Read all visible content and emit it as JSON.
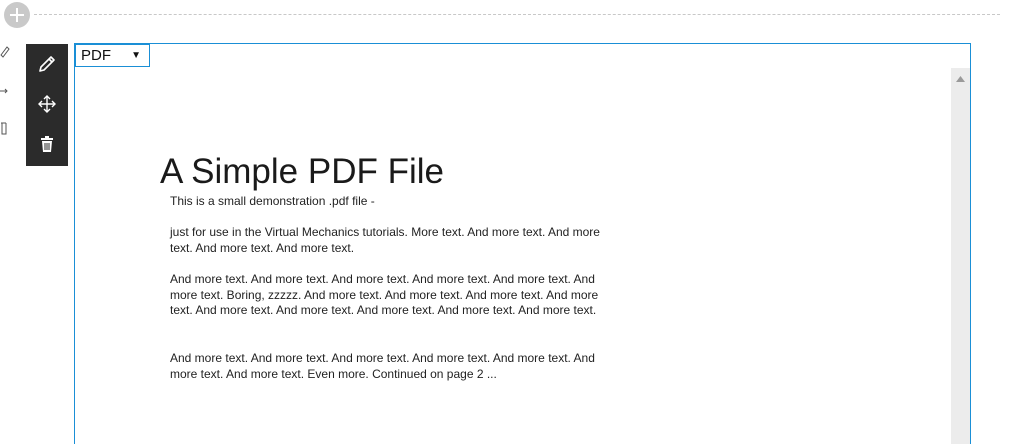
{
  "editor": {
    "add_icon": "plus-icon",
    "tools": [
      {
        "name": "edit-button",
        "icon": "pencil-icon"
      },
      {
        "name": "move-button",
        "icon": "move-arrows-icon"
      },
      {
        "name": "delete-button",
        "icon": "trash-icon"
      }
    ]
  },
  "block": {
    "type_select": "PDF",
    "accent_color": "#1a8fd6"
  },
  "document": {
    "title": "A Simple PDF File",
    "paragraphs": [
      "This is a small demonstration .pdf file -",
      "just for use in the Virtual Mechanics tutorials. More text. And more text. And more text. And more text. And more text.",
      "And more text. And more text. And more text. And more text. And more text. And more text. Boring, zzzzz. And more text. And more text. And more text. And more text. And more text. And more text. And more text. And more text. And more text.",
      "And more text. And more text. And more text. And more text. And more text. And more text. And more text. Even more. Continued on page 2 ..."
    ]
  }
}
